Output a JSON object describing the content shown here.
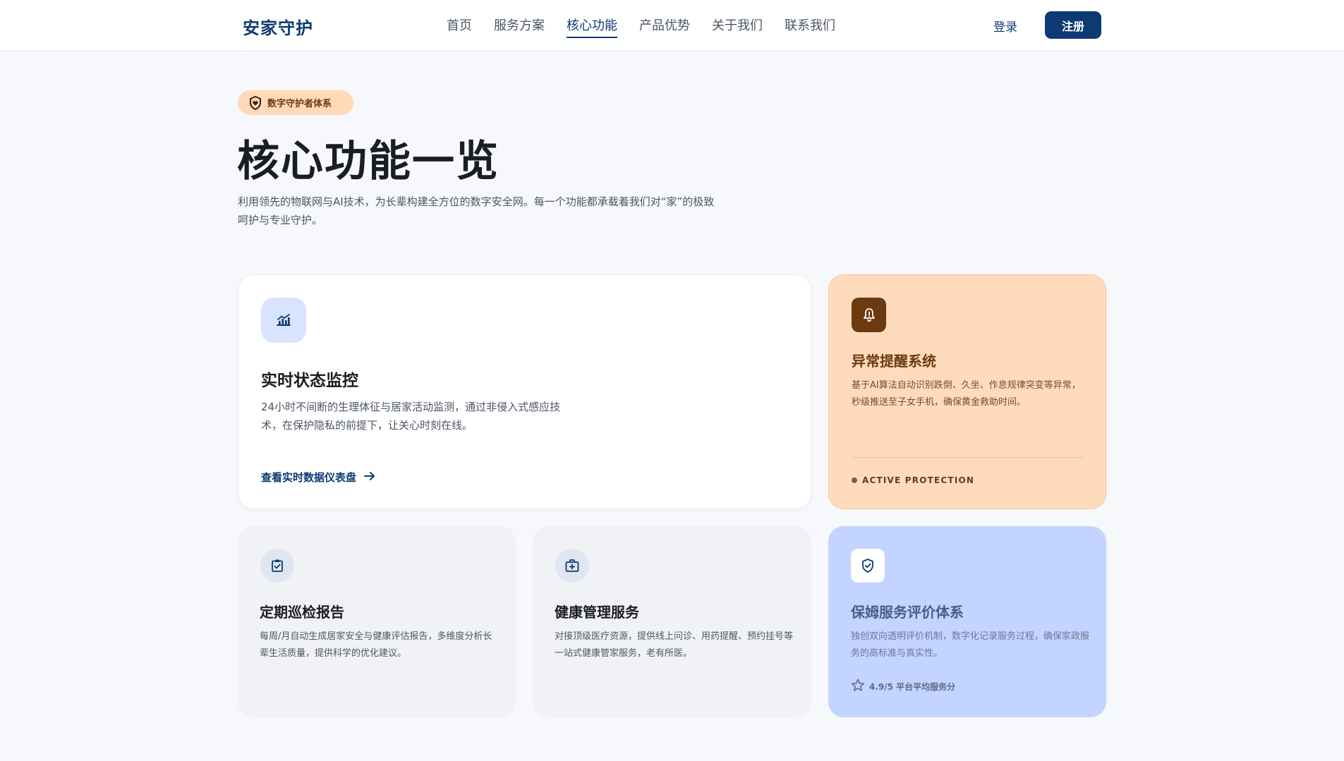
{
  "header": {
    "brand": "安家守护",
    "nav": [
      {
        "label": "首页",
        "active": false
      },
      {
        "label": "服务方案",
        "active": false
      },
      {
        "label": "核心功能",
        "active": true
      },
      {
        "label": "产品优势",
        "active": false
      },
      {
        "label": "关于我们",
        "active": false
      },
      {
        "label": "联系我们",
        "active": false
      }
    ],
    "login_label": "登录",
    "signup_label": "注册"
  },
  "hero": {
    "badge_icon": "shield-heart-icon",
    "badge_label": "数字守护者体系",
    "title": "核心功能一览",
    "description": "利用领先的物联网与AI技术，为长辈构建全方位的数字安全网。每一个功能都承载着我们对“家”的极致呵护与专业守护。"
  },
  "cards": {
    "monitor": {
      "icon": "chart-icon",
      "title": "实时状态监控",
      "description": "24小时不间断的生理体征与居家活动监测，通过非侵入式感应技术，在保护隐私的前提下，让关心时刻在线。",
      "link_label": "查看实时数据仪表盘"
    },
    "alert": {
      "icon": "bell-icon",
      "title": "异常提醒系统",
      "description": "基于AI算法自动识别跌倒、久坐、作息规律突变等异常，秒级推送至子女手机，确保黄金救助时间。",
      "status": "ACTIVE PROTECTION"
    },
    "report": {
      "icon": "clipboard-check-icon",
      "title": "定期巡检报告",
      "description": "每周/月自动生成居家安全与健康评估报告，多维度分析长辈生活质量，提供科学的优化建议。"
    },
    "health": {
      "icon": "medical-kit-icon",
      "title": "健康管理服务",
      "description": "对接顶级医疗资源，提供线上问诊、用药提醒、预约挂号等一站式健康管家服务，老有所医。"
    },
    "nanny": {
      "icon": "shield-check-icon",
      "title": "保姆服务评价体系",
      "description": "独创双向透明评价机制，数字化记录服务过程，确保家政服务的高标准与真实性。",
      "rating": "4.9/5 平台平均服务分"
    }
  },
  "colors": {
    "primary": "#0d3a73",
    "alert_bg": "#ffdbbd",
    "nanny_bg": "#c2d4ff",
    "badge_bg": "#ffd9b8"
  }
}
